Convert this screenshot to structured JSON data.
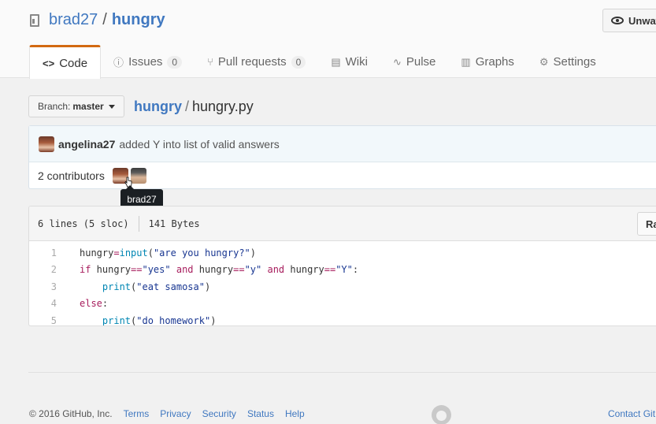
{
  "repo": {
    "owner": "brad27",
    "separator": "/",
    "name": "hungry"
  },
  "watch_button": {
    "label": "Unwat"
  },
  "tabs": [
    {
      "label": "Code",
      "icon": "<>",
      "active": true
    },
    {
      "label": "Issues",
      "icon": "ⓘ",
      "count": "0"
    },
    {
      "label": "Pull requests",
      "icon": "⑂",
      "count": "0"
    },
    {
      "label": "Wiki",
      "icon": "▤"
    },
    {
      "label": "Pulse",
      "icon": "∿"
    },
    {
      "label": "Graphs",
      "icon": "▥"
    },
    {
      "label": "Settings",
      "icon": "⚙"
    }
  ],
  "branch": {
    "prefix": "Branch:",
    "value": "master"
  },
  "breadcrumb": {
    "repo": "hungry",
    "separator": "/",
    "file": "hungry.py"
  },
  "commit": {
    "author": "angelina27",
    "message": "added Y into list of valid answers"
  },
  "contributors": {
    "label": "2 contributors",
    "tooltip": "brad27"
  },
  "file": {
    "lines_info": "6 lines (5 sloc)",
    "size": "141 Bytes",
    "raw_label": "Raw",
    "line_numbers": [
      "1",
      "2",
      "3",
      "4",
      "5"
    ]
  },
  "footer": {
    "copyright": "© 2016 GitHub, Inc.",
    "links": [
      "Terms",
      "Privacy",
      "Security",
      "Status",
      "Help"
    ],
    "contact": "Contact Git"
  },
  "colors": {
    "link": "#4078c0",
    "active_tab_border": "#d26911",
    "keyword": "#a71d5d",
    "string": "#183691",
    "builtin": "#0086b3"
  }
}
